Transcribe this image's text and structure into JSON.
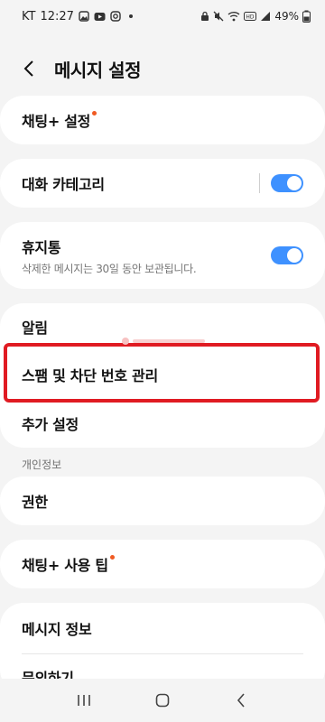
{
  "status_bar": {
    "carrier": "KT",
    "time": "12:27",
    "battery": "49%",
    "left_icons": [
      "gallery-icon",
      "youtube-icon",
      "instagram-icon"
    ],
    "right_icons": [
      "lock-icon",
      "mute-icon",
      "wifi-icon",
      "hd-icon",
      "signal-icon"
    ]
  },
  "header": {
    "title": "메시지 설정"
  },
  "items": {
    "chat_plus_settings": "채팅+ 설정",
    "categories": "대화 카테고리",
    "trash": "휴지통",
    "trash_sub": "삭제한 메시지는 30일 동안 보관됩니다.",
    "notifications": "알림",
    "spam": "스팸 및 차단 번호 관리",
    "more": "추가 설정",
    "privacy_header": "개인정보",
    "permissions": "권한",
    "chat_plus_tips": "채팅+ 사용 팁",
    "about": "메시지 정보",
    "contact": "문의하기"
  },
  "toggles": {
    "categories": true,
    "trash": true
  },
  "colors": {
    "accent": "#3e91ff",
    "badge": "#f05a22",
    "highlight": "#e01b22"
  }
}
